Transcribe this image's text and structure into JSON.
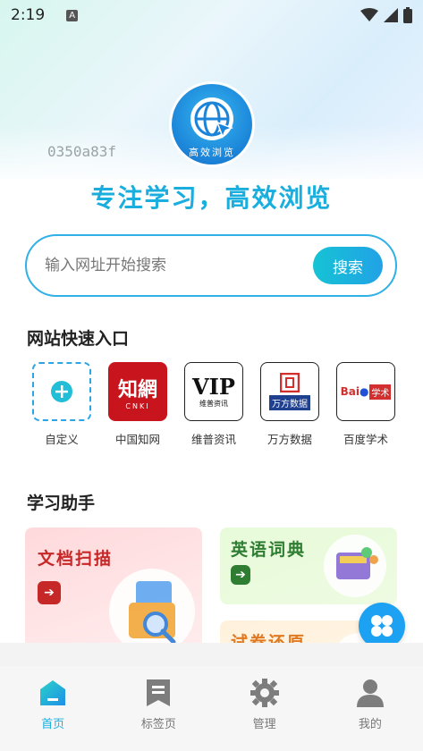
{
  "status_bar": {
    "time": "2:19",
    "notification_badge": "A"
  },
  "header": {
    "logo_text": "高效浏览",
    "device_id": "0350a83f",
    "slogan": "专注学习，高效浏览"
  },
  "search": {
    "placeholder": "输入网址开始搜索",
    "button_label": "搜索"
  },
  "quick_entries": {
    "title": "网站快速入口",
    "items": [
      {
        "label": "自定义",
        "icon": "plus-icon"
      },
      {
        "label": "中国知网",
        "icon": "cnki-logo",
        "logo_text": "知網",
        "sub_text": "CNKI"
      },
      {
        "label": "维普资讯",
        "icon": "vip-logo",
        "logo_text": "VIP",
        "sub_text": "维普资讯"
      },
      {
        "label": "万方数据",
        "icon": "wanfang-logo",
        "logo_text": "万方数据"
      },
      {
        "label": "百度学术",
        "icon": "baidu-xueshu-logo",
        "logo_text": "Bai",
        "sub_text": "学术"
      }
    ]
  },
  "assistant": {
    "title": "学习助手",
    "cards": [
      {
        "title": "文档扫描",
        "icon": "folder-search-icon",
        "accent": "#c62828"
      },
      {
        "title": "英语词典",
        "icon": "dictionary-icon",
        "accent": "#2e7d32"
      },
      {
        "title": "试卷还原",
        "icon": "paper-icon",
        "accent": "#e07a22"
      }
    ]
  },
  "tabs": [
    {
      "label": "首页",
      "icon": "home-icon",
      "active": true
    },
    {
      "label": "标签页",
      "icon": "bookmark-icon",
      "active": false
    },
    {
      "label": "管理",
      "icon": "gear-icon",
      "active": false
    },
    {
      "label": "我的",
      "icon": "user-icon",
      "active": false
    }
  ],
  "colors": {
    "accent": "#1aaede",
    "brand_blue": "#1da1f2"
  }
}
